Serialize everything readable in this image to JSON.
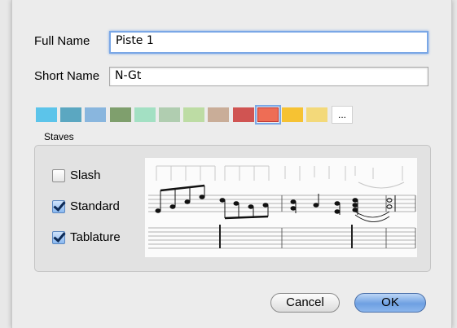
{
  "form": {
    "full_name_label": "Full Name",
    "full_name_value": "Piste 1",
    "short_name_label": "Short Name",
    "short_name_value": "N-Gt"
  },
  "colors": {
    "swatches": [
      "#5cc4ea",
      "#5ba7c1",
      "#89b6de",
      "#7f9f6d",
      "#a3e0c3",
      "#b0cdb0",
      "#bddca4",
      "#c9ad98",
      "#d05452",
      "#ee6d55",
      "#f6c233",
      "#f3d97a"
    ],
    "selected_index": 9,
    "more_label": "..."
  },
  "staves": {
    "title": "Staves",
    "options": [
      {
        "label": "Slash",
        "checked": false
      },
      {
        "label": "Standard",
        "checked": true
      },
      {
        "label": "Tablature",
        "checked": true
      }
    ]
  },
  "buttons": {
    "cancel": "Cancel",
    "ok": "OK"
  }
}
